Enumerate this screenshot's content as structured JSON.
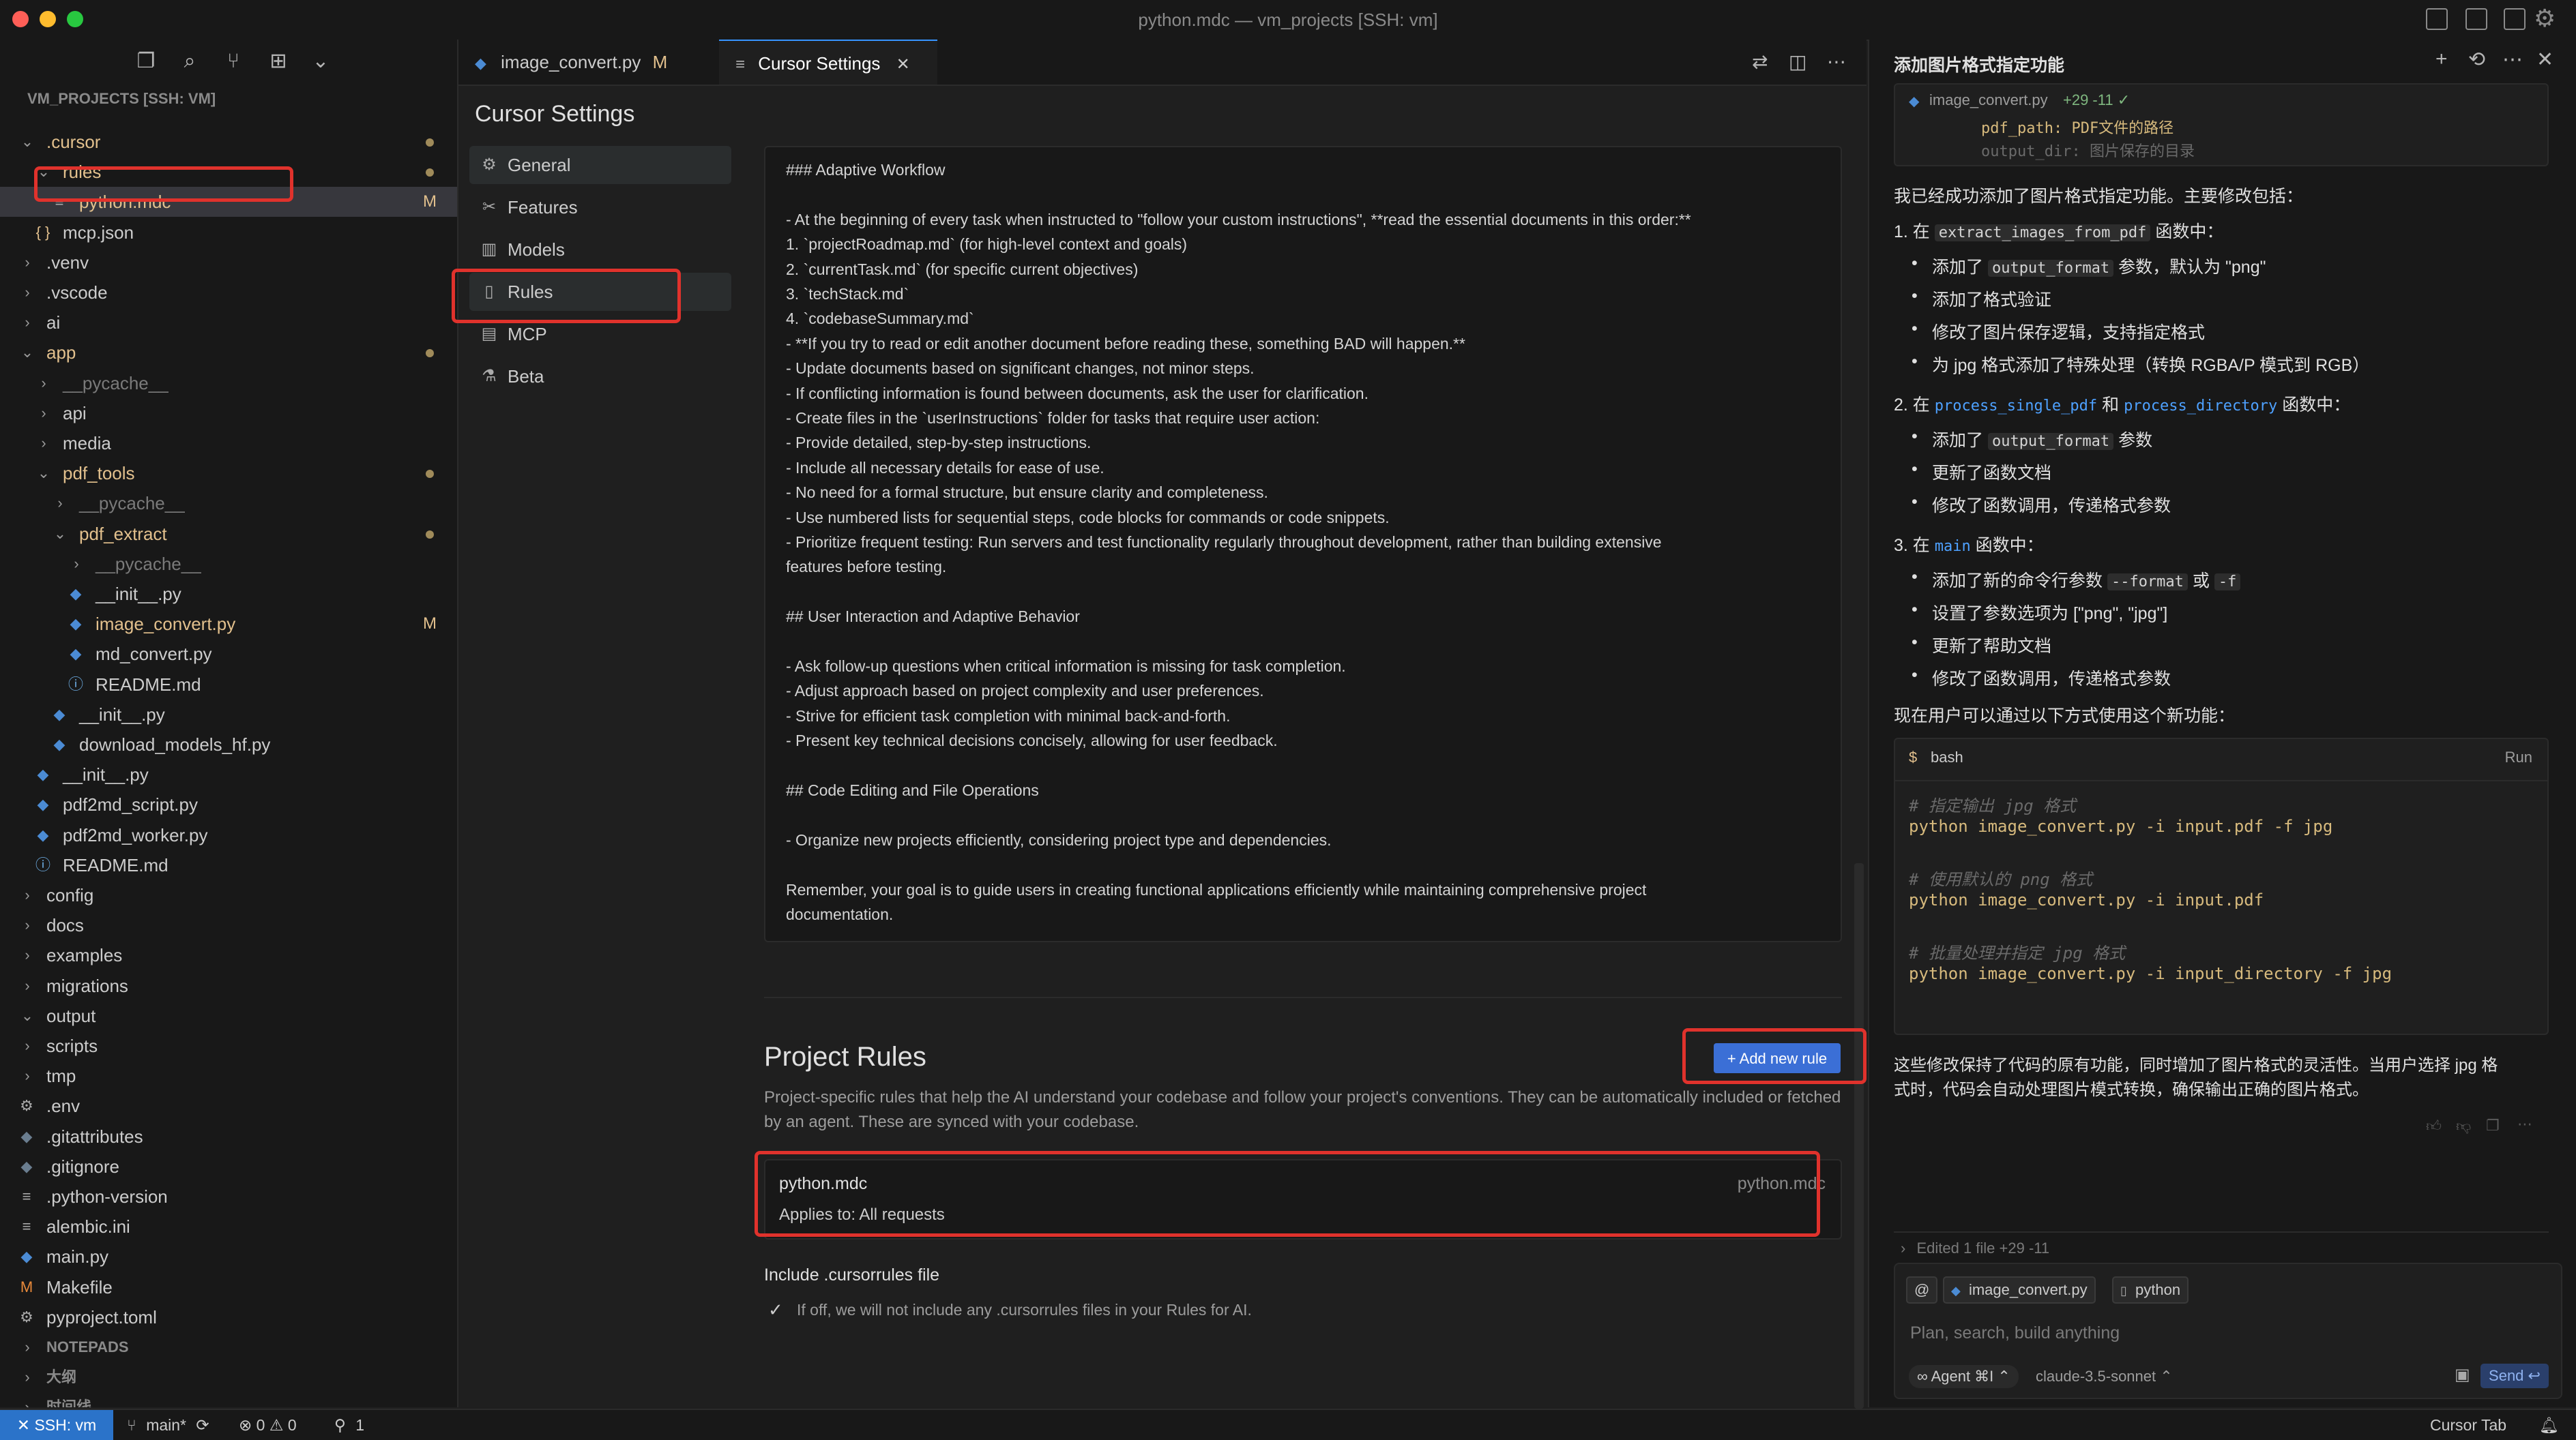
{
  "window": {
    "title": "python.mdc — vm_projects [SSH: vm]"
  },
  "explorer": {
    "section_title": "VM_PROJECTS [SSH: VM]",
    "tree": [
      {
        "label": ".cursor",
        "indent": 0,
        "kind": "folder-open",
        "color": "mod",
        "dot": true
      },
      {
        "label": "rules",
        "indent": 1,
        "kind": "folder-open",
        "color": "mod",
        "dot": true
      },
      {
        "label": "python.mdc",
        "indent": 2,
        "kind": "file-lines",
        "color": "mod",
        "badge": "M",
        "active": true
      },
      {
        "label": "mcp.json",
        "indent": 1,
        "kind": "file-json"
      },
      {
        "label": ".venv",
        "indent": 0,
        "kind": "folder"
      },
      {
        "label": ".vscode",
        "indent": 0,
        "kind": "folder"
      },
      {
        "label": "ai",
        "indent": 0,
        "kind": "folder"
      },
      {
        "label": "app",
        "indent": 0,
        "kind": "folder-open",
        "color": "mod",
        "dot": true
      },
      {
        "label": "__pycache__",
        "indent": 1,
        "kind": "folder",
        "color": "dim"
      },
      {
        "label": "api",
        "indent": 1,
        "kind": "folder"
      },
      {
        "label": "media",
        "indent": 1,
        "kind": "folder"
      },
      {
        "label": "pdf_tools",
        "indent": 1,
        "kind": "folder-open",
        "color": "mod",
        "dot": true
      },
      {
        "label": "__pycache__",
        "indent": 2,
        "kind": "folder",
        "color": "dim"
      },
      {
        "label": "pdf_extract",
        "indent": 2,
        "kind": "folder-open",
        "color": "mod",
        "dot": true
      },
      {
        "label": "__pycache__",
        "indent": 3,
        "kind": "folder",
        "color": "dim"
      },
      {
        "label": "__init__.py",
        "indent": 3,
        "kind": "file-py"
      },
      {
        "label": "image_convert.py",
        "indent": 3,
        "kind": "file-py",
        "color": "mod",
        "badge": "M"
      },
      {
        "label": "md_convert.py",
        "indent": 3,
        "kind": "file-py"
      },
      {
        "label": "README.md",
        "indent": 3,
        "kind": "file-info"
      },
      {
        "label": "__init__.py",
        "indent": 2,
        "kind": "file-py"
      },
      {
        "label": "download_models_hf.py",
        "indent": 2,
        "kind": "file-py"
      },
      {
        "label": "__init__.py",
        "indent": 1,
        "kind": "file-py"
      },
      {
        "label": "pdf2md_script.py",
        "indent": 1,
        "kind": "file-py"
      },
      {
        "label": "pdf2md_worker.py",
        "indent": 1,
        "kind": "file-py"
      },
      {
        "label": "README.md",
        "indent": 1,
        "kind": "file-info"
      },
      {
        "label": "config",
        "indent": 0,
        "kind": "folder"
      },
      {
        "label": "docs",
        "indent": 0,
        "kind": "folder"
      },
      {
        "label": "examples",
        "indent": 0,
        "kind": "folder"
      },
      {
        "label": "migrations",
        "indent": 0,
        "kind": "folder"
      },
      {
        "label": "output",
        "indent": 0,
        "kind": "folder-open"
      },
      {
        "label": "scripts",
        "indent": 0,
        "kind": "folder"
      },
      {
        "label": "tmp",
        "indent": 0,
        "kind": "folder"
      },
      {
        "label": ".env",
        "indent": 0,
        "kind": "file-gear"
      },
      {
        "label": ".gitattributes",
        "indent": 0,
        "kind": "file-git"
      },
      {
        "label": ".gitignore",
        "indent": 0,
        "kind": "file-git"
      },
      {
        "label": ".python-version",
        "indent": 0,
        "kind": "file-lines"
      },
      {
        "label": "alembic.ini",
        "indent": 0,
        "kind": "file-lines"
      },
      {
        "label": "main.py",
        "indent": 0,
        "kind": "file-py"
      },
      {
        "label": "Makefile",
        "indent": 0,
        "kind": "file-make"
      },
      {
        "label": "pyproject.toml",
        "indent": 0,
        "kind": "file-gear"
      },
      {
        "label": "NOTEPADS",
        "indent": 0,
        "kind": "section"
      },
      {
        "label": "大纲",
        "indent": 0,
        "kind": "section"
      },
      {
        "label": "时间线",
        "indent": 0,
        "kind": "section"
      }
    ]
  },
  "tabs": [
    {
      "label": "image_convert.py",
      "badge": "M"
    },
    {
      "label": "Cursor Settings",
      "close": "✕"
    }
  ],
  "settings": {
    "title": "Cursor Settings",
    "nav": [
      "General",
      "Features",
      "Models",
      "Rules",
      "MCP",
      "Beta"
    ],
    "rules_text": [
      "### Adaptive Workflow",
      "",
      "- At the beginning of every task when instructed to \"follow your custom instructions\", **read the essential documents in this order:**",
      "1. `projectRoadmap.md` (for high-level context and goals)",
      "2. `currentTask.md` (for specific current objectives)",
      "3. `techStack.md`",
      "4. `codebaseSummary.md`",
      "- **If you try to read or edit another document before reading these, something BAD will happen.**",
      "- Update documents based on significant changes, not minor steps.",
      "- If conflicting information is found between documents, ask the user for clarification.",
      "- Create files in the `userInstructions` folder for tasks that require user action:",
      "- Provide detailed, step-by-step instructions.",
      "- Include all necessary details for ease of use.",
      "- No need for a formal structure, but ensure clarity and completeness.",
      "- Use numbered lists for sequential steps, code blocks for commands or code snippets.",
      "- Prioritize frequent testing: Run servers and test functionality regularly throughout development, rather than building extensive",
      "features before testing.",
      "",
      "## User Interaction and Adaptive Behavior",
      "",
      "- Ask follow-up questions when critical information is missing for task completion.",
      "- Adjust approach based on project complexity and user preferences.",
      "- Strive for efficient task completion with minimal back-and-forth.",
      "- Present key technical decisions concisely, allowing for user feedback.",
      "",
      "## Code Editing and File Operations",
      "",
      "- Organize new projects efficiently, considering project type and dependencies.",
      "",
      "Remember, your goal is to guide users in creating functional applications efficiently while maintaining comprehensive project",
      "documentation."
    ],
    "project_rules": {
      "title": "Project Rules",
      "description": "Project-specific rules that help the AI understand your codebase and follow your project's conventions. They can be automatically included or fetched by an agent. These are synced with your codebase.",
      "add_button": "+ Add new rule",
      "rule": {
        "name": "python.mdc",
        "applies": "Applies to: All requests",
        "file": "python.mdc"
      }
    },
    "include": {
      "label": "Include .cursorrules file",
      "check": "✓",
      "description": "If off, we will not include any .cursorrules files in your Rules for AI."
    }
  },
  "chat": {
    "title": "添加图片格式指定功能",
    "context": {
      "file": "image_convert.py",
      "diff": "+29 -11 ✓",
      "line1": "pdf_path: PDF文件的路径",
      "line2": "output_dir: 图片保存的目录"
    },
    "intro": "我已经成功添加了图片格式指定功能。主要修改包括：",
    "step1": {
      "prefix": "1. 在 ",
      "code": "extract_images_from_pdf",
      "suffix": " 函数中："
    },
    "step1_bullets": [
      {
        "pre": "添加了 ",
        "code": "output_format",
        "post": " 参数，默认为 \"png\""
      },
      {
        "pre": "添加了格式验证",
        "code": "",
        "post": ""
      },
      {
        "pre": "修改了图片保存逻辑，支持指定格式",
        "code": "",
        "post": ""
      },
      {
        "pre": "为 jpg 格式添加了特殊处理（转换 RGBA/P 模式到 RGB）",
        "code": "",
        "post": ""
      }
    ],
    "step2": {
      "prefix": "2. 在 ",
      "code1": "process_single_pdf",
      "mid": " 和 ",
      "code2": "process_directory",
      "suffix": " 函数中："
    },
    "step2_bullets": [
      {
        "pre": "添加了 ",
        "code": "output_format",
        "post": " 参数"
      },
      {
        "pre": "更新了函数文档",
        "code": "",
        "post": ""
      },
      {
        "pre": "修改了函数调用，传递格式参数",
        "code": "",
        "post": ""
      }
    ],
    "step3": {
      "prefix": "3. 在 ",
      "code": "main",
      "suffix": " 函数中："
    },
    "step3_bullets": [
      {
        "pre": "添加了新的命令行参数 ",
        "code": "--format",
        "mid": " 或 ",
        "code2": "-f"
      },
      {
        "pre": "设置了参数选项为 [\"png\", \"jpg\"]"
      },
      {
        "pre": "更新了帮助文档"
      },
      {
        "pre": "修改了函数调用，传递格式参数"
      }
    ],
    "usage_intro": "现在用户可以通过以下方式使用这个新功能：",
    "codeblock": {
      "lang": "bash",
      "run": "Run",
      "lines": [
        {
          "t": "# 指定输出 jpg 格式",
          "k": "comment"
        },
        {
          "t": "python image_convert.py -i input.pdf -f jpg",
          "k": "cmd"
        },
        {
          "t": "",
          "k": "blank"
        },
        {
          "t": "# 使用默认的 png 格式",
          "k": "comment"
        },
        {
          "t": "python image_convert.py -i input.pdf",
          "k": "cmd"
        },
        {
          "t": "",
          "k": "blank"
        },
        {
          "t": "# 批量处理并指定 jpg 格式",
          "k": "comment"
        },
        {
          "t": "python image_convert.py -i input_directory -f jpg",
          "k": "cmd"
        }
      ]
    },
    "summary_line1": "这些修改保持了代码的原有功能，同时增加了图片格式的灵活性。当用户选择 jpg 格",
    "summary_line2": "式时，代码会自动处理图片模式转换，确保输出正确的图片格式。",
    "edited": "Edited 1 file +29 -11",
    "composer": {
      "at": "@",
      "chip_file": "image_convert.py",
      "chip_lang": "python",
      "placeholder": "Plan, search, build anything",
      "agent": "∞ Agent ⌘I ⌃",
      "model": "claude-3.5-sonnet ⌃",
      "send": "Send ↩"
    }
  },
  "statusbar": {
    "remote": "✕ SSH: vm",
    "branch": "main*",
    "problems": "⊗ 0 ⚠ 0",
    "ports": "1",
    "cursor_tab": "Cursor Tab"
  },
  "colors": {
    "accent": "#3794ff",
    "annotation": "#e0322c",
    "modified": "#e2c08d"
  }
}
